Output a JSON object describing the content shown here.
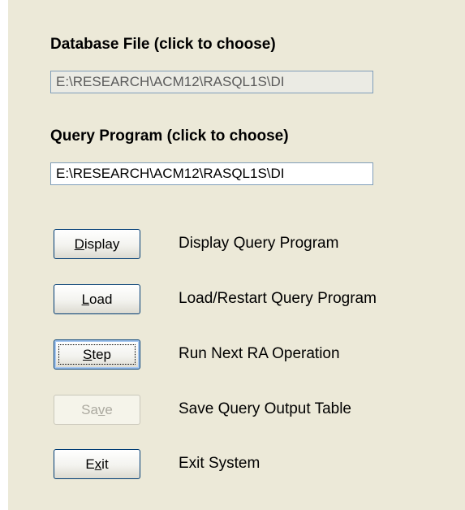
{
  "database": {
    "label": "Database File (click to choose)",
    "value": "E:\\RESEARCH\\ACM12\\RASQL1S\\DI"
  },
  "query": {
    "label": "Query Program (click to choose)",
    "value": "E:\\RESEARCH\\ACM12\\RASQL1S\\DI"
  },
  "actions": [
    {
      "pre": "",
      "key": "D",
      "post": "isplay",
      "description": "Display Query Program",
      "state": "enabled"
    },
    {
      "pre": "",
      "key": "L",
      "post": "oad",
      "description": "Load/Restart Query Program",
      "state": "enabled"
    },
    {
      "pre": "",
      "key": "S",
      "post": "tep",
      "description": "Run Next RA Operation",
      "state": "focused"
    },
    {
      "pre": "Sa",
      "key": "v",
      "post": "e",
      "description": "Save Query Output Table",
      "state": "disabled"
    },
    {
      "pre": "E",
      "key": "x",
      "post": "it",
      "description": "Exit System",
      "state": "enabled"
    }
  ]
}
